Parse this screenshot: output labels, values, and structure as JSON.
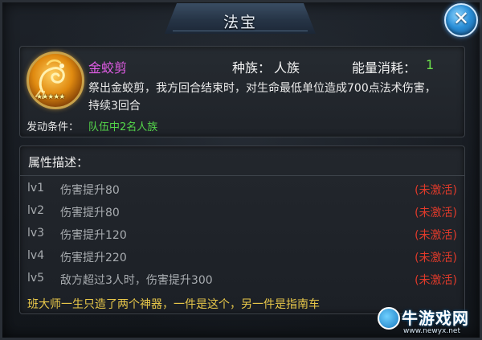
{
  "header": {
    "title": "法宝",
    "close_icon": "close-icon",
    "close_glyph": "✕",
    "accent": "#2a8fd8"
  },
  "treasure": {
    "icon": "golden-dragon-scissors-icon",
    "stars": "★★★★★",
    "name": "金蛟剪",
    "name_color": "#e25ce6",
    "race_label": "种族：",
    "race_value": "人族",
    "energy_label": "能量消耗：",
    "energy_value": "1",
    "effect": "祭出金蛟剪，我方回合结束时，对生命最低单位造成700点法术伤害，持续3回合",
    "trigger_label": "发动条件：",
    "trigger_value": "队伍中2名人族"
  },
  "attributes": {
    "title": "属性描述：",
    "levels": [
      {
        "lv": "lv1",
        "desc": "伤害提升80",
        "status": "(未激活)"
      },
      {
        "lv": "lv2",
        "desc": "伤害提升80",
        "status": "(未激活)"
      },
      {
        "lv": "lv3",
        "desc": "伤害提升120",
        "status": "(未激活)"
      },
      {
        "lv": "lv4",
        "desc": "伤害提升220",
        "status": "(未激活)"
      },
      {
        "lv": "lv5",
        "desc": "敌方超过3人时，伤害提升300",
        "status": "(未激活)"
      }
    ],
    "lore": "班大师一生只造了两个神器，一件是这个，另一件是指南车"
  },
  "watermark": {
    "logo_icon": "niu-logo-icon",
    "name": "牛游戏网",
    "url": "www.newyx.net"
  }
}
